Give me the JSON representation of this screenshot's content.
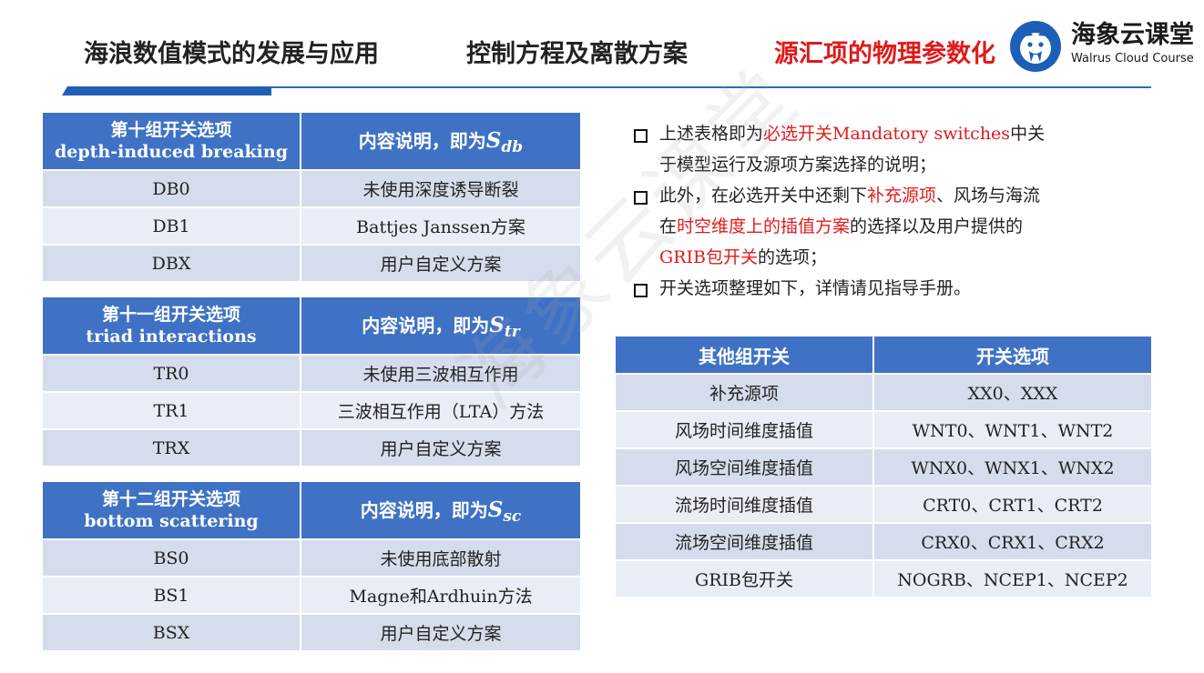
{
  "header": {
    "nav": [
      {
        "label": "海浪数值模式的发展与应用",
        "active": false
      },
      {
        "label": "控制方程及离散方案",
        "active": false
      },
      {
        "label": "源汇项的物理参数化",
        "active": true
      }
    ],
    "logo_cn": "海象云课堂",
    "logo_en": "Walrus Cloud Course"
  },
  "colors": {
    "accent": "#1f5fb4",
    "header_cell": "#3f72c4",
    "row_dark": "#d5dcec",
    "row_light": "#e9edf6",
    "highlight": "#e01a1a"
  },
  "tables": [
    {
      "title_cn": "第十组开关选项",
      "title_en": "depth-induced breaking",
      "desc_label": "内容说明，即为",
      "math_main": "S",
      "math_sub": "db",
      "rows": [
        {
          "key": "DB0",
          "value": "未使用深度诱导断裂"
        },
        {
          "key": "DB1",
          "value": "Battjes Janssen方案"
        },
        {
          "key": "DBX",
          "value": "用户自定义方案"
        }
      ]
    },
    {
      "title_cn": "第十一组开关选项",
      "title_en": "triad interactions",
      "desc_label": "内容说明，即为",
      "math_main": "S",
      "math_sub": "tr",
      "rows": [
        {
          "key": "TR0",
          "value": "未使用三波相互作用"
        },
        {
          "key": "TR1",
          "value": "三波相互作用（LTA）方法"
        },
        {
          "key": "TRX",
          "value": "用户自定义方案"
        }
      ]
    },
    {
      "title_cn": "第十二组开关选项",
      "title_en": "bottom scattering",
      "desc_label": "内容说明，即为",
      "math_main": "S",
      "math_sub": "sc",
      "rows": [
        {
          "key": "BS0",
          "value": "未使用底部散射"
        },
        {
          "key": "BS1",
          "value": "Magne和Ardhuin方法"
        },
        {
          "key": "BSX",
          "value": "用户自定义方案"
        }
      ]
    }
  ],
  "bullets": [
    {
      "line1": {
        "a": "上述表格即为",
        "red": "必选开关Mandatory switches",
        "b": "中关"
      },
      "line2": "于模型运行及源项方案选择的说明；"
    },
    {
      "line1": {
        "a": "此外，在必选开关中还剩下",
        "red": "补充源项",
        "b": "、风场与海流"
      },
      "line2": {
        "a": "在",
        "red": "时空维度上的插值方案",
        "b": "的选择以及用户提供的"
      },
      "line3": {
        "red": "GRIB包开关",
        "b": "的选项；"
      }
    },
    {
      "line1": "开关选项整理如下，详情请见指导手册。"
    }
  ],
  "other_table": {
    "headers": [
      "其他组开关",
      "开关选项"
    ],
    "rows": [
      {
        "name": "补充源项",
        "options": "XX0、XXX"
      },
      {
        "name": "风场时间维度插值",
        "options": "WNT0、WNT1、WNT2"
      },
      {
        "name": "风场空间维度插值",
        "options": "WNX0、WNX1、WNX2"
      },
      {
        "name": "流场时间维度插值",
        "options": "CRT0、CRT1、CRT2"
      },
      {
        "name": "流场空间维度插值",
        "options": "CRX0、CRX1、CRX2"
      },
      {
        "name": "GRIB包开关",
        "options": "NOGRB、NCEP1、NCEP2"
      }
    ]
  },
  "watermark": "海象云课堂"
}
